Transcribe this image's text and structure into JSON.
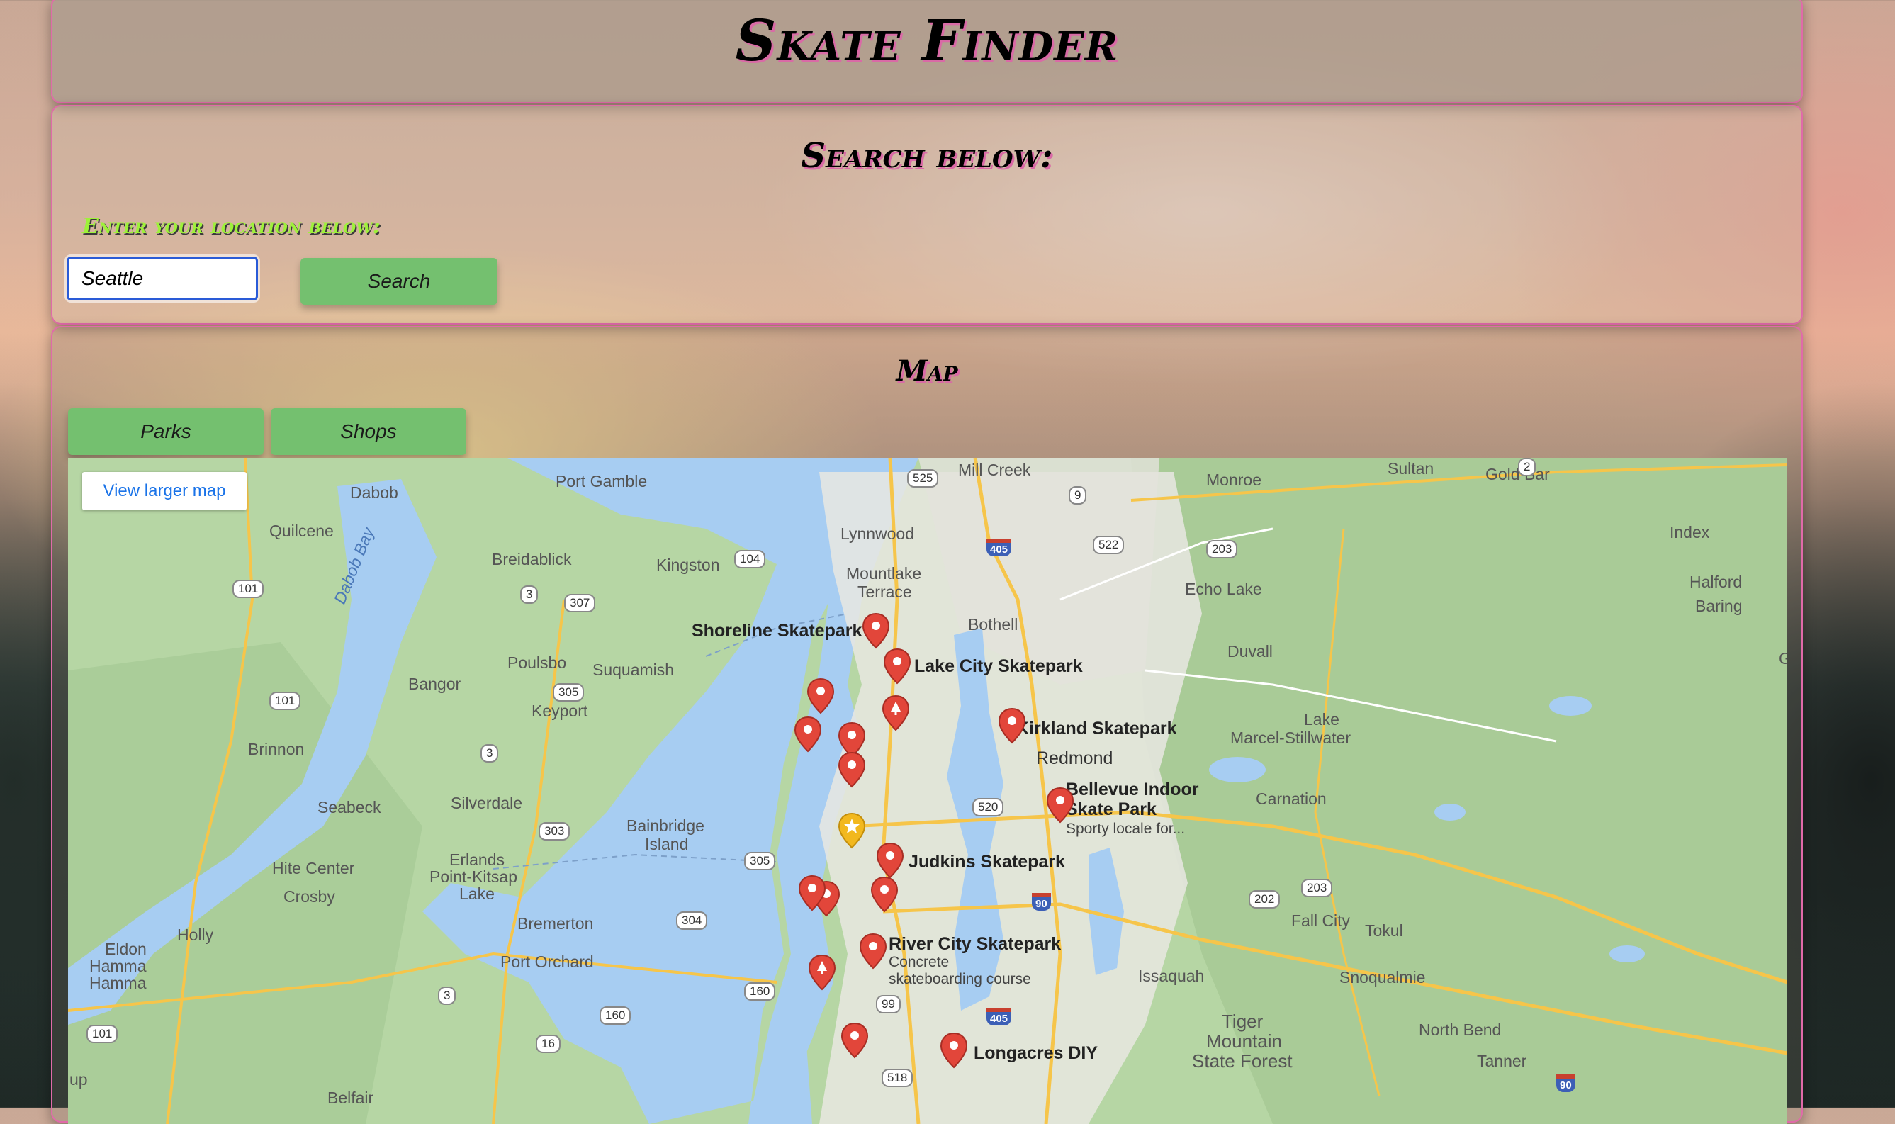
{
  "header": {
    "title": "Skate Finder"
  },
  "search": {
    "heading": "Search below:",
    "location_label": "Enter your location below:",
    "input_value": "Seattle",
    "button_label": "Search"
  },
  "map_section": {
    "heading": "Map",
    "tabs": [
      {
        "label": "Parks"
      },
      {
        "label": "Shops"
      }
    ],
    "view_larger_label": "View larger map",
    "places": [
      {
        "name": "Shoreline Skatepark"
      },
      {
        "name": "Lake City Skatepark"
      },
      {
        "name": "Kirkland Skatepark"
      },
      {
        "name": "Bellevue Indoor Skate Park",
        "line1": "Bellevue Indoor",
        "line2": "Skate Park",
        "subtitle": "Sporty locale for..."
      },
      {
        "name": "Judkins Skatepark"
      },
      {
        "name": "River City Skatepark",
        "subtitle1": "Concrete",
        "subtitle2": "skateboarding course"
      },
      {
        "name": "Longacres DIY"
      }
    ],
    "towns": {
      "mill_creek": "Mill Creek",
      "sultan": "Sultan",
      "monroe": "Monroe",
      "gold_bar": "Gold Bar",
      "port_gamble": "Port Gamble",
      "dabob": "Dabob",
      "quilcene": "Quilcene",
      "lynnwood": "Lynnwood",
      "index": "Index",
      "breidablick": "Breidablick",
      "kingston": "Kingston",
      "mountlake": "Mountlake",
      "terrace": "Terrace",
      "echo_lake": "Echo Lake",
      "halford": "Halford",
      "baring": "Baring",
      "bothell": "Bothell",
      "duvall": "Duvall",
      "poulsbo": "Poulsbo",
      "suquamish": "Suquamish",
      "g": "G",
      "bangor": "Bangor",
      "keyport": "Keyport",
      "lake": "Lake",
      "marcel": "Marcel-Stillwater",
      "brinnon": "Brinnon",
      "redmond": "Redmond",
      "silverdale": "Silverdale",
      "seabeck": "Seabeck",
      "carnation": "Carnation",
      "bainbridge": "Bainbridge",
      "island": "Island",
      "erlands": "Erlands",
      "point_kitsap": "Point-Kitsap",
      "lake2": "Lake",
      "hite": "Hite Center",
      "crosby": "Crosby",
      "bremerton": "Bremerton",
      "fall_city": "Fall City",
      "tokul": "Tokul",
      "holly": "Holly",
      "eldon": "Eldon",
      "hamma1": "Hamma",
      "hamma2": "Hamma",
      "port_orchard": "Port Orchard",
      "issaquah": "Issaquah",
      "snoqualmie": "Snoqualmie",
      "tiger": "Tiger",
      "mountain": "Mountain",
      "state_forest": "State Forest",
      "north_bend": "North Bend",
      "tanner": "Tanner",
      "belfair": "Belfair",
      "up": "up",
      "dabob_bay": "Dabob Bay"
    },
    "shields": [
      "525",
      "9",
      "405",
      "522",
      "2",
      "104",
      "3",
      "307",
      "203",
      "305",
      "101",
      "3",
      "101",
      "520",
      "303",
      "305",
      "304",
      "90",
      "202",
      "203",
      "3",
      "160",
      "99",
      "405",
      "16",
      "160",
      "101",
      "518",
      "90"
    ]
  }
}
